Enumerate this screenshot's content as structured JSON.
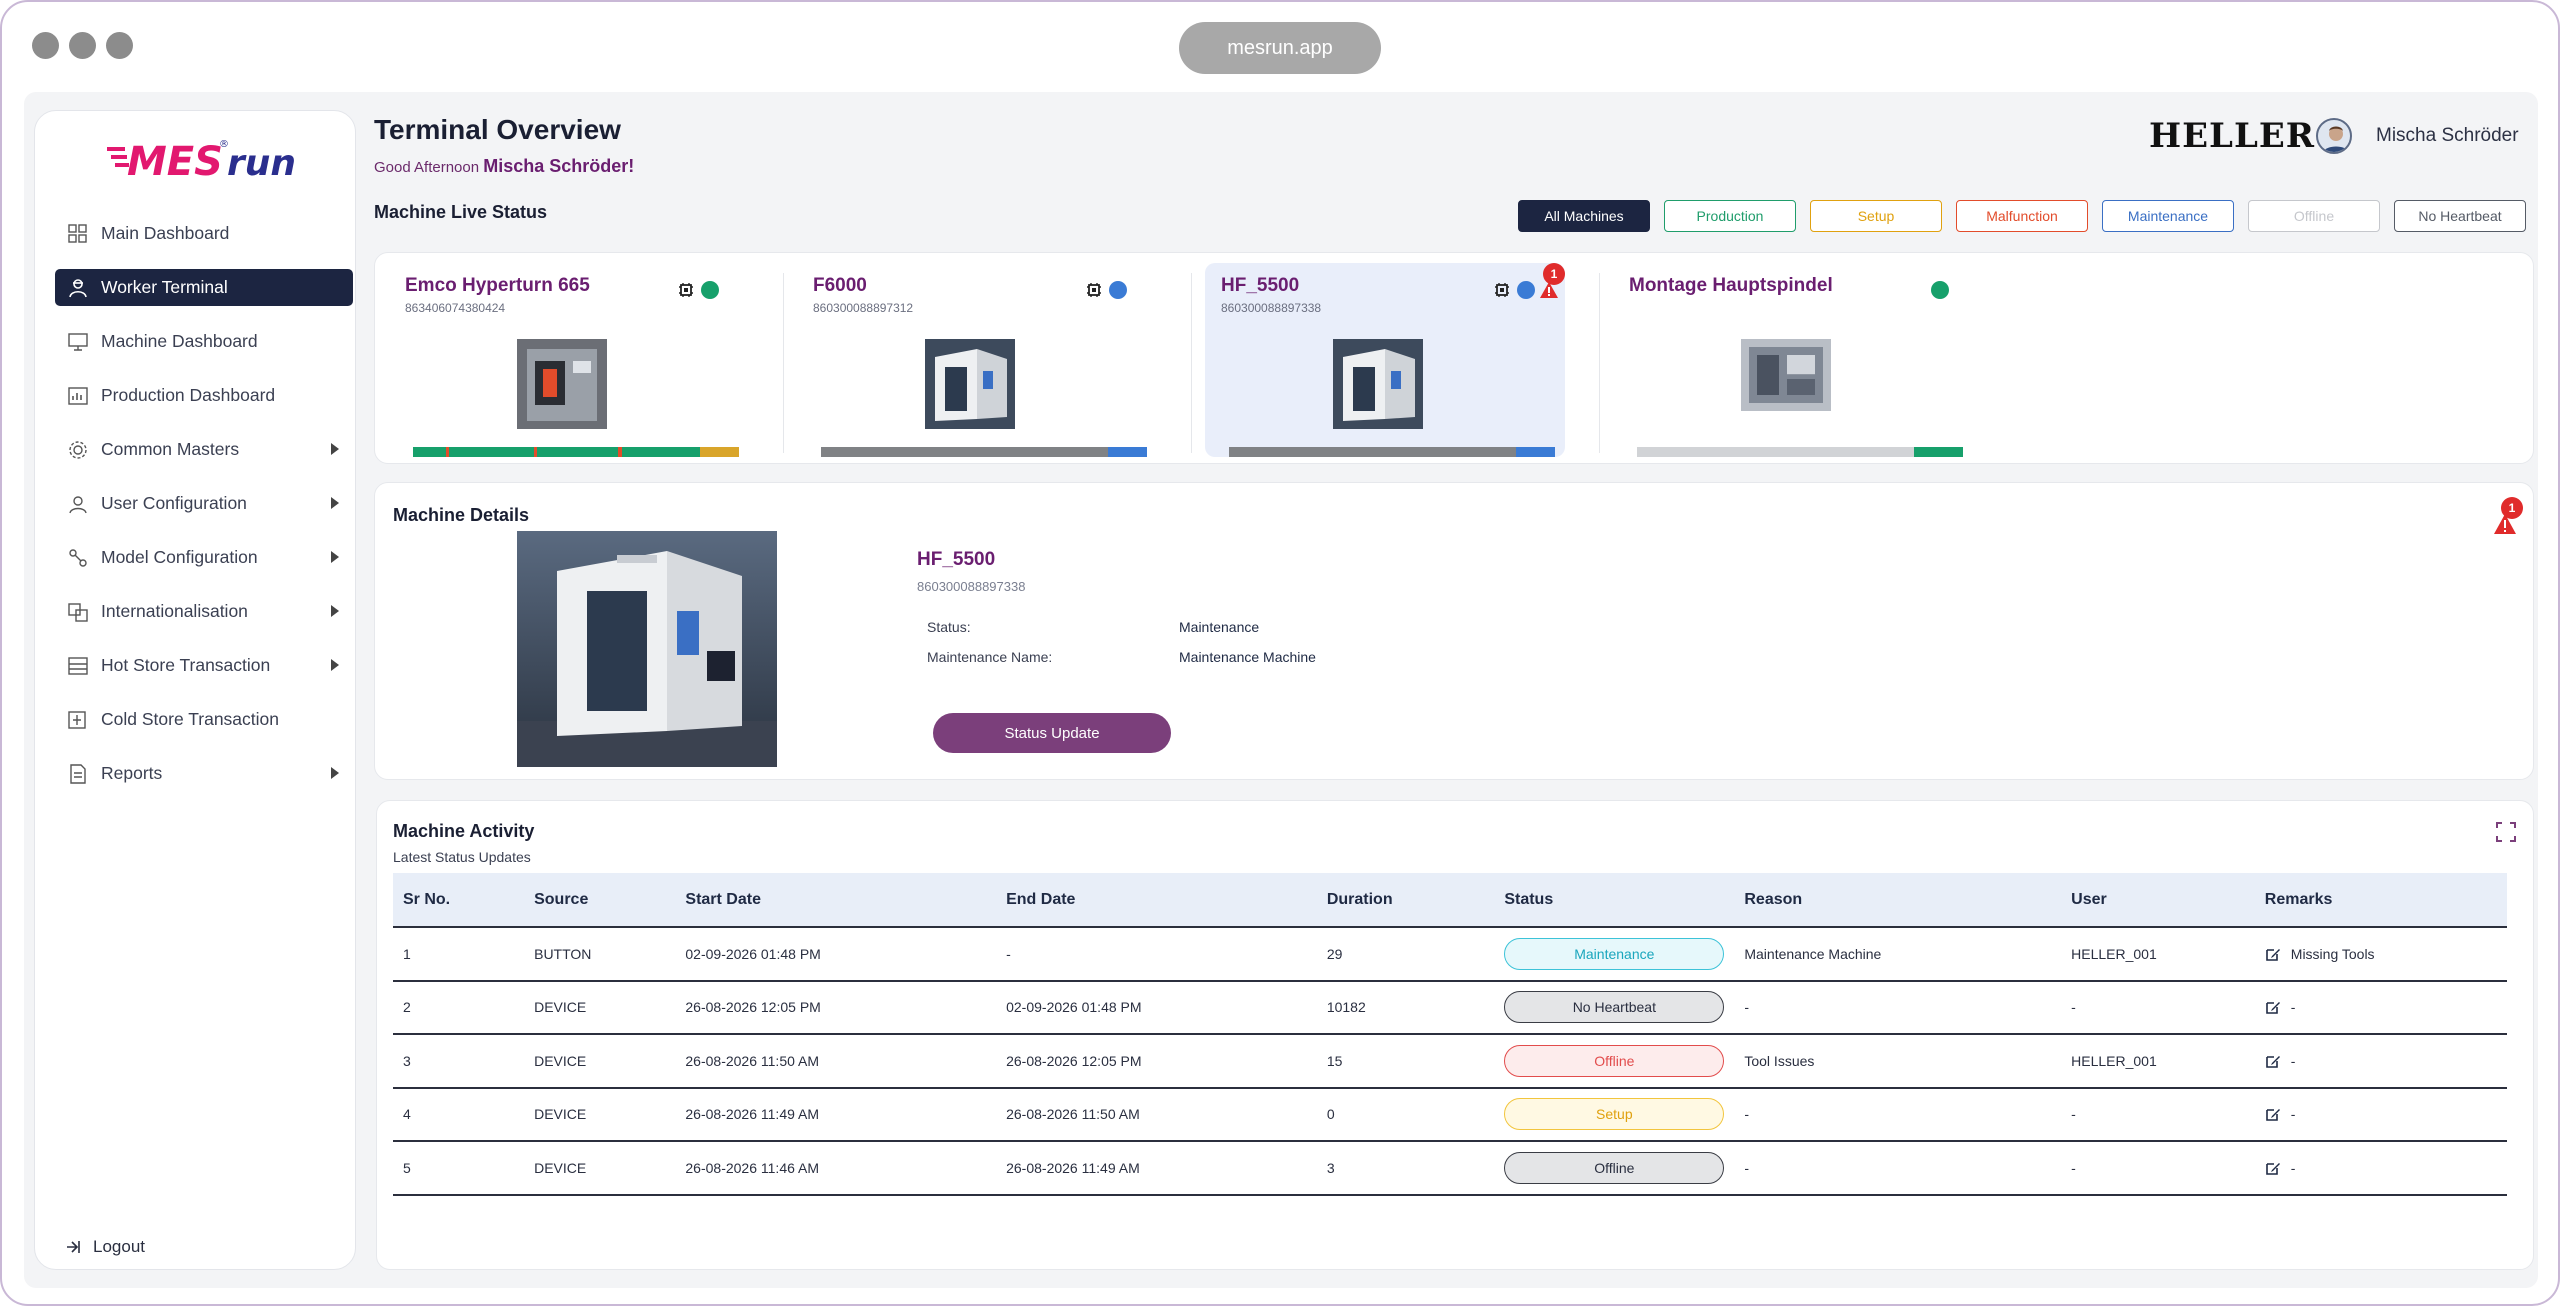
{
  "browser": {
    "url": "mesrun.app"
  },
  "brand": {
    "logo_text_left": "MES",
    "logo_text_right": "run",
    "logo_reg": "®",
    "logo_color": "#e2186f",
    "logo_color_dark": "#2a2e8e"
  },
  "sidebar": {
    "items": [
      {
        "label": "Main Dashboard",
        "icon": "grid-icon",
        "active": false,
        "expandable": false
      },
      {
        "label": "Worker Terminal",
        "icon": "worker-icon",
        "active": true,
        "expandable": false
      },
      {
        "label": "Machine Dashboard",
        "icon": "monitor-icon",
        "active": false,
        "expandable": false
      },
      {
        "label": "Production Dashboard",
        "icon": "chart-icon",
        "active": false,
        "expandable": false
      },
      {
        "label": "Common Masters",
        "icon": "gear-icon",
        "active": false,
        "expandable": true
      },
      {
        "label": "User Configuration",
        "icon": "user-gear-icon",
        "active": false,
        "expandable": true
      },
      {
        "label": "Model Configuration",
        "icon": "model-icon",
        "active": false,
        "expandable": true
      },
      {
        "label": "Internationalisation",
        "icon": "translate-icon",
        "active": false,
        "expandable": true
      },
      {
        "label": "Hot Store Transaction",
        "icon": "store-icon",
        "active": false,
        "expandable": true
      },
      {
        "label": "Cold Store Transaction",
        "icon": "cold-store-icon",
        "active": false,
        "expandable": false
      },
      {
        "label": "Reports",
        "icon": "document-icon",
        "active": false,
        "expandable": true
      }
    ],
    "logout": "Logout"
  },
  "header": {
    "title": "Terminal Overview",
    "greeting": "Good Afternoon",
    "user_name_greet": "Mischa Schröder!",
    "company": "HELLER",
    "user_name": "Mischa Schröder"
  },
  "live_status": {
    "label": "Machine Live Status",
    "filters": [
      {
        "label": "All Machines",
        "color": "#1c2541",
        "active": true
      },
      {
        "label": "Production",
        "color": "#1f9d6b",
        "active": false
      },
      {
        "label": "Setup",
        "color": "#e0a10f",
        "active": false
      },
      {
        "label": "Malfunction",
        "color": "#e24c2b",
        "active": false
      },
      {
        "label": "Maintenance",
        "color": "#3a6fc4",
        "active": false
      },
      {
        "label": "Offline",
        "color": "#c5c7cc",
        "active": false
      },
      {
        "label": "No Heartbeat",
        "color": "#555b66",
        "active": false
      }
    ],
    "machines": [
      {
        "name": "Emco Hyperturn 665",
        "serial": "863406074380424",
        "status_color": "#17a06b",
        "chip": true,
        "alert": null,
        "selected": false,
        "bar": [
          {
            "c": "#17a06b",
            "f": 0.1
          },
          {
            "c": "#e24c2b",
            "f": 0.01
          },
          {
            "c": "#17a06b",
            "f": 0.26
          },
          {
            "c": "#e24c2b",
            "f": 0.01
          },
          {
            "c": "#17a06b",
            "f": 0.25
          },
          {
            "c": "#e24c2b",
            "f": 0.01
          },
          {
            "c": "#17a06b",
            "f": 0.24
          },
          {
            "c": "#d9a52a",
            "f": 0.12
          }
        ]
      },
      {
        "name": "F6000",
        "serial": "860300088897312",
        "status_color": "#3a7bd5",
        "chip": true,
        "alert": null,
        "selected": false,
        "bar": [
          {
            "c": "#808285",
            "f": 0.88
          },
          {
            "c": "#3a7bd5",
            "f": 0.12
          }
        ]
      },
      {
        "name": "HF_5500",
        "serial": "860300088897338",
        "status_color": "#3a7bd5",
        "chip": true,
        "alert": "1",
        "selected": true,
        "bar": [
          {
            "c": "#808285",
            "f": 0.88
          },
          {
            "c": "#3a7bd5",
            "f": 0.12
          }
        ]
      },
      {
        "name": "Montage Hauptspindel",
        "serial": "",
        "status_color": "#17a06b",
        "chip": false,
        "alert": null,
        "selected": false,
        "bar": [
          {
            "c": "#d1d3d6",
            "f": 0.85
          },
          {
            "c": "#17a06b",
            "f": 0.15
          }
        ]
      }
    ]
  },
  "details": {
    "heading": "Machine Details",
    "name": "HF_5500",
    "serial": "860300088897338",
    "status_label": "Status:",
    "status_value": "Maintenance",
    "maint_label": "Maintenance Name:",
    "maint_value": "Maintenance Machine",
    "button": "Status Update",
    "alert_count": "1"
  },
  "activity": {
    "heading": "Machine Activity",
    "subheading": "Latest Status Updates",
    "columns": [
      "Sr No.",
      "Source",
      "Start Date",
      "End Date",
      "Duration",
      "Status",
      "Reason",
      "User",
      "Remarks"
    ],
    "rows": [
      {
        "sr": "1",
        "source": "BUTTON",
        "start": "02-09-2026 01:48 PM",
        "end": "-",
        "duration": "29",
        "status": "Maintenance",
        "status_style": "maintenance",
        "reason": "Maintenance Machine",
        "user": "HELLER_001",
        "remarks": "Missing Tools"
      },
      {
        "sr": "2",
        "source": "DEVICE",
        "start": "26-08-2026 12:05 PM",
        "end": "02-09-2026 01:48 PM",
        "duration": "10182",
        "status": "No Heartbeat",
        "status_style": "noheartbeat",
        "reason": "-",
        "user": "-",
        "remarks": "-"
      },
      {
        "sr": "3",
        "source": "DEVICE",
        "start": "26-08-2026 11:50 AM",
        "end": "26-08-2026 12:05 PM",
        "duration": "15",
        "status": "Offline",
        "status_style": "offline-red",
        "reason": "Tool Issues",
        "user": "HELLER_001",
        "remarks": "-"
      },
      {
        "sr": "4",
        "source": "DEVICE",
        "start": "26-08-2026 11:49 AM",
        "end": "26-08-2026 11:50 AM",
        "duration": "0",
        "status": "Setup",
        "status_style": "setup",
        "reason": "-",
        "user": "-",
        "remarks": "-"
      },
      {
        "sr": "5",
        "source": "DEVICE",
        "start": "26-08-2026 11:46 AM",
        "end": "26-08-2026 11:49 AM",
        "duration": "3",
        "status": "Offline",
        "status_style": "offline-grey",
        "reason": "-",
        "user": "-",
        "remarks": "-"
      }
    ]
  }
}
